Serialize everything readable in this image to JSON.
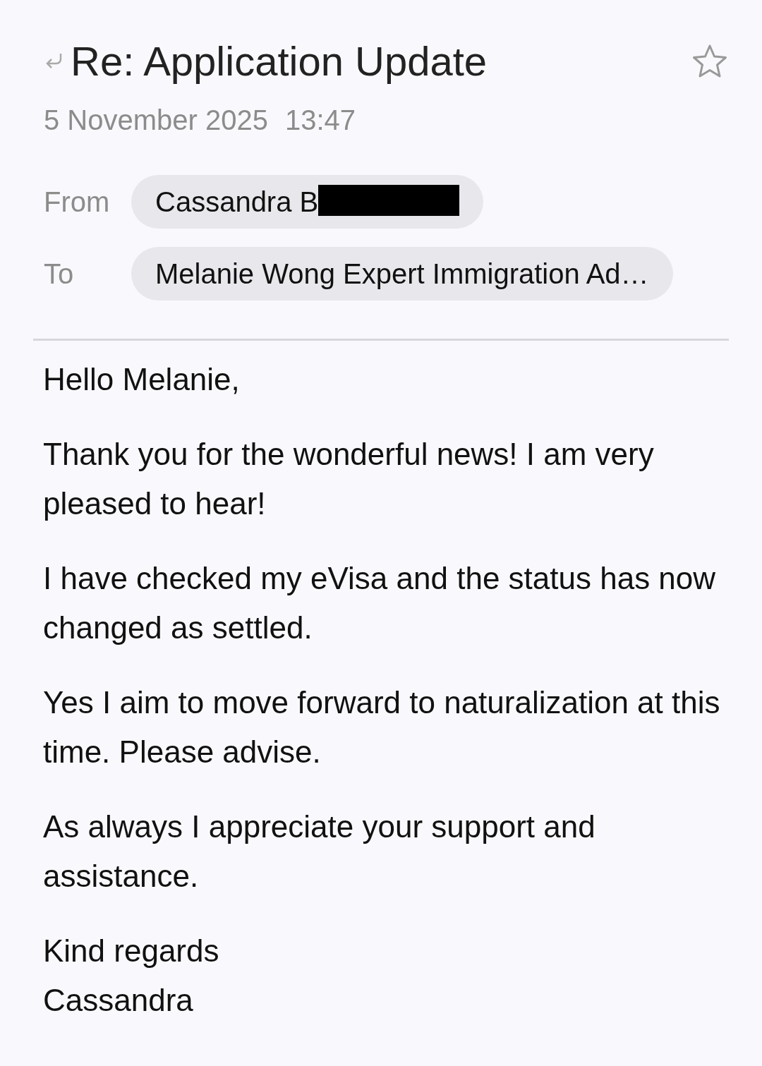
{
  "email": {
    "subject": "Re: Application Update",
    "replied": true,
    "starred": false,
    "date": "5 November 2025",
    "time": "13:47"
  },
  "from": {
    "label": "From",
    "name": "Cassandra B",
    "redacted": true
  },
  "to": {
    "label": "To",
    "name": "Melanie Wong Expert Immigration Ad…"
  },
  "body": {
    "paragraphs": [
      "Hello Melanie,",
      "Thank you for the wonderful news! I am very pleased to hear!",
      "I have checked my eVisa and the status has now changed as settled.",
      "Yes I aim to move forward to naturalization at this time. Please advise.",
      "As always I appreciate your support and assistance."
    ],
    "closing": [
      "Kind regards",
      "Cassandra"
    ]
  }
}
